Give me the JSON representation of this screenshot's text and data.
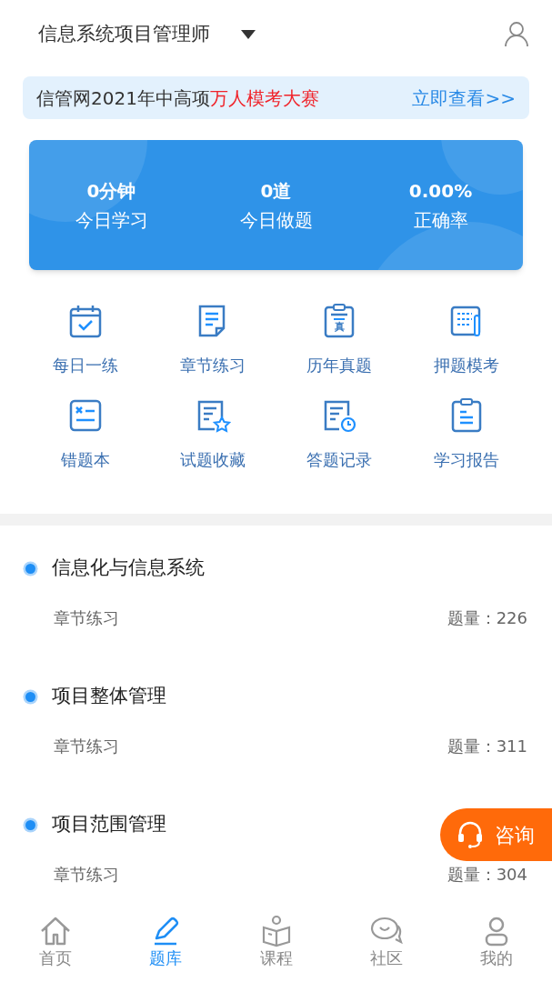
{
  "header": {
    "title": "信息系统项目管理师"
  },
  "banner": {
    "text": "信管网2021年中高项",
    "highlight": "万人模考大赛",
    "link": "立即查看>>"
  },
  "stats": [
    {
      "value": "0分钟",
      "label": "今日学习"
    },
    {
      "value": "0道",
      "label": "今日做题"
    },
    {
      "value": "0.00%",
      "label": "正确率"
    }
  ],
  "features": [
    {
      "kind": "calendar",
      "label": "每日一练"
    },
    {
      "kind": "document",
      "label": "章节练习"
    },
    {
      "kind": "clipboard",
      "label": "历年真题",
      "icon_char": "真"
    },
    {
      "kind": "sheet",
      "label": "押题模考"
    },
    {
      "kind": "wrong",
      "label": "错题本"
    },
    {
      "kind": "star",
      "label": "试题收藏"
    },
    {
      "kind": "clock",
      "label": "答题记录"
    },
    {
      "kind": "report",
      "label": "学习报告"
    }
  ],
  "chapters": [
    {
      "title": "信息化与信息系统",
      "subtitle": "章节练习",
      "count": "题量：226"
    },
    {
      "title": "项目整体管理",
      "subtitle": "章节练习",
      "count": "题量：311"
    },
    {
      "title": "项目范围管理",
      "subtitle": "章节练习",
      "count": "题量：304"
    }
  ],
  "consult_button": {
    "label": "咨询"
  },
  "tabs": [
    {
      "kind": "home",
      "label": "首页",
      "selected": false
    },
    {
      "kind": "pencil",
      "label": "题库",
      "selected": true
    },
    {
      "kind": "book",
      "label": "课程",
      "selected": false
    },
    {
      "kind": "chat",
      "label": "社区",
      "selected": false
    },
    {
      "kind": "user",
      "label": "我的",
      "selected": false
    }
  ]
}
